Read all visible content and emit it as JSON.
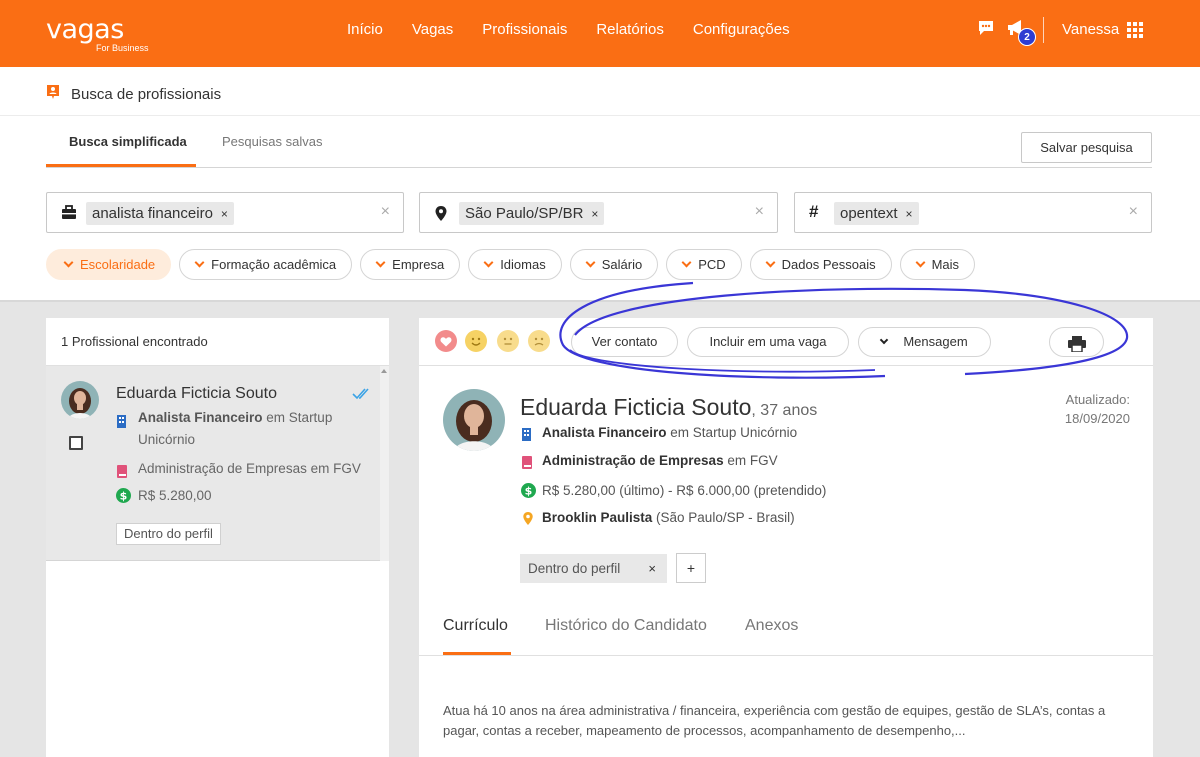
{
  "brand": {
    "logo": "vagas",
    "logo_sub": "For Business",
    "accent": "#fa6e14"
  },
  "nav": [
    "Início",
    "Vagas",
    "Profissionais",
    "Relatórios",
    "Configurações"
  ],
  "header_icons": {
    "chat": "chat-icon",
    "notifications": "megaphone-icon",
    "notification_count": "2",
    "apps": "grid-icon"
  },
  "user": {
    "name": "Vanessa"
  },
  "page": {
    "title": "Busca de profissionais",
    "title_icon": "person-card-icon"
  },
  "search_tabs": {
    "simple": "Busca simplificada",
    "saved": "Pesquisas salvas"
  },
  "save_search_label": "Salvar pesquisa",
  "search_fields": [
    {
      "icon": "briefcase-icon",
      "chip": "analista financeiro",
      "remove": "×",
      "clear": "×"
    },
    {
      "icon": "location-pin-icon",
      "chip": "São Paulo/SP/BR",
      "remove": "×",
      "clear": "×"
    },
    {
      "icon": "hashtag-icon",
      "chip": "opentext",
      "remove": "×",
      "clear": "×"
    }
  ],
  "filters": [
    "Escolaridade",
    "Formação acadêmica",
    "Empresa",
    "Idiomas",
    "Salário",
    "PCD",
    "Dados Pessoais",
    "Mais"
  ],
  "results": {
    "count_label": "1 Profissional encontrado",
    "items": [
      {
        "name": "Eduarda Ficticia Souto",
        "job_title": "Analista Financeiro",
        "job_connector": " em Startup",
        "job_company_cont": "Unicórnio",
        "education": "Administração de Empresas em FGV",
        "salary": "R$ 5.280,00",
        "tag": "Dentro do perfil"
      }
    ]
  },
  "detail": {
    "actions": {
      "view_contact": "Ver contato",
      "add_to_job": "Incluir em uma vaga",
      "message": "Mensagem",
      "print_icon": "printer-icon"
    },
    "reactions": [
      "heart-icon",
      "happy-face-icon",
      "neutral-face-icon",
      "sad-face-icon"
    ],
    "name": "Eduarda Ficticia Souto",
    "age": ", 37 anos",
    "updated_label": "Atualizado:",
    "updated_date": "18/09/2020",
    "job_title": "Analista Financeiro",
    "job_rest": " em Startup Unicórnio",
    "education_title": "Administração de Empresas",
    "education_rest": " em FGV",
    "salary": "R$ 5.280,00 (último) - R$ 6.000,00 (pretendido)",
    "location_title": "Brooklin Paulista",
    "location_rest": " (São Paulo/SP - Brasil)",
    "tag": "Dentro do perfil",
    "tag_remove": "×",
    "add_tag": "+",
    "tabs": [
      "Currículo",
      "Histórico do Candidato",
      "Anexos"
    ],
    "summary": "Atua há 10 anos na área administrativa / financeira, experiência com gestão de equipes, gestão de SLA’s, contas a pagar, contas a receber, mapeamento de processos, acompanhamento de desempenho,..."
  }
}
